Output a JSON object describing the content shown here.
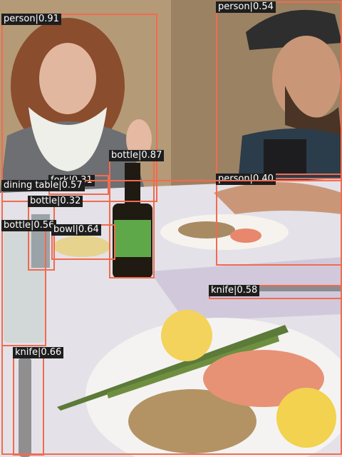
{
  "image": {
    "description_none": "",
    "box_color": "#f26b4f",
    "label_bg": "#1e1e1e",
    "label_fg": "#ffffff"
  },
  "detections": [
    {
      "id": "person-1",
      "label": "person|0.91"
    },
    {
      "id": "person-2",
      "label": "person|0.54"
    },
    {
      "id": "person-3",
      "label": "person|0.40"
    },
    {
      "id": "bottle-1",
      "label": "bottle|0.87"
    },
    {
      "id": "bottle-2",
      "label": "bottle|0.32"
    },
    {
      "id": "bottle-3",
      "label": "bottle|0.56"
    },
    {
      "id": "fork-1",
      "label": "fork|0.31"
    },
    {
      "id": "dining-table-1",
      "label": "dining table|0.57"
    },
    {
      "id": "bowl-1",
      "label": "bowl|0.64"
    },
    {
      "id": "knife-1",
      "label": "knife|0.58"
    },
    {
      "id": "knife-2",
      "label": "knife|0.66"
    }
  ]
}
